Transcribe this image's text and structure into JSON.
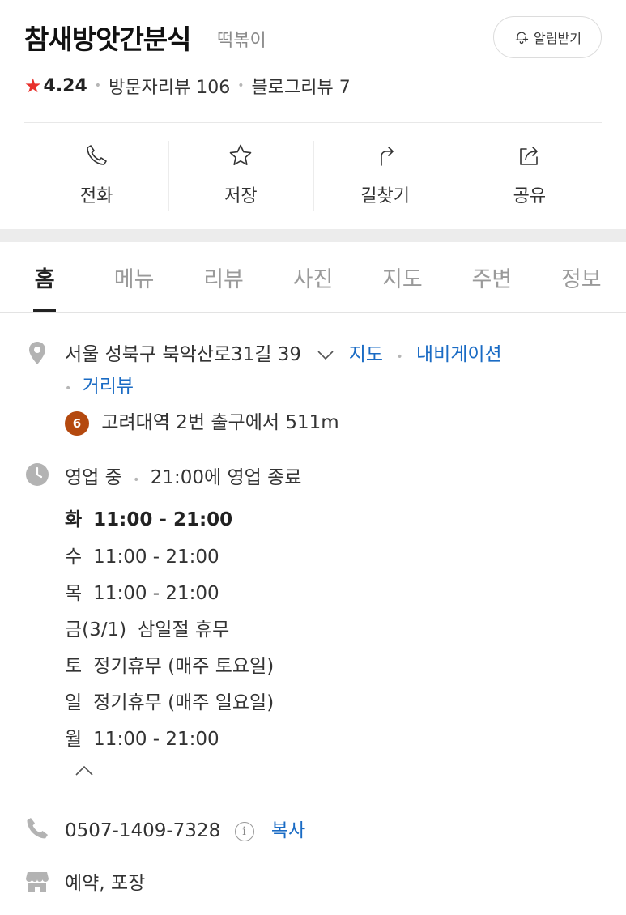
{
  "header": {
    "title": "참새방앗간분식",
    "category": "떡볶이",
    "notify_label": "알림받기",
    "rating": "4.24",
    "visitor_reviews": "방문자리뷰 106",
    "blog_reviews": "블로그리뷰 7"
  },
  "actions": [
    {
      "label": "전화",
      "icon": "phone-icon"
    },
    {
      "label": "저장",
      "icon": "star-icon"
    },
    {
      "label": "길찾기",
      "icon": "directions-icon"
    },
    {
      "label": "공유",
      "icon": "share-icon"
    }
  ],
  "tabs": [
    "홈",
    "메뉴",
    "리뷰",
    "사진",
    "지도",
    "주변",
    "정보"
  ],
  "address": {
    "text": "서울 성북구 북악산로31길 39",
    "map_link": "지도",
    "navigation_link": "내비게이션",
    "street_view_link": "거리뷰",
    "subway_line": "6",
    "subway_text": "고려대역 2번 출구에서 511m"
  },
  "hours": {
    "status": "영업 중",
    "closing_text": "21:00에 영업 종료",
    "schedule": [
      {
        "day": "화",
        "time": "11:00 - 21:00"
      },
      {
        "day": "수",
        "time": "11:00 - 21:00"
      },
      {
        "day": "목",
        "time": "11:00 - 21:00"
      },
      {
        "day": "금(3/1)",
        "time": "삼일절 휴무"
      },
      {
        "day": "토",
        "time": "정기휴무 (매주 토요일)"
      },
      {
        "day": "일",
        "time": "정기휴무 (매주 일요일)"
      },
      {
        "day": "월",
        "time": "11:00 - 21:00"
      }
    ]
  },
  "phone": {
    "number": "0507-1409-7328",
    "info_glyph": "i",
    "copy_label": "복사"
  },
  "services": {
    "text": "예약, 포장"
  },
  "colors": {
    "accent_link": "#1a6bc4",
    "star": "#e8312c",
    "subway_line6": "#b4490f"
  }
}
